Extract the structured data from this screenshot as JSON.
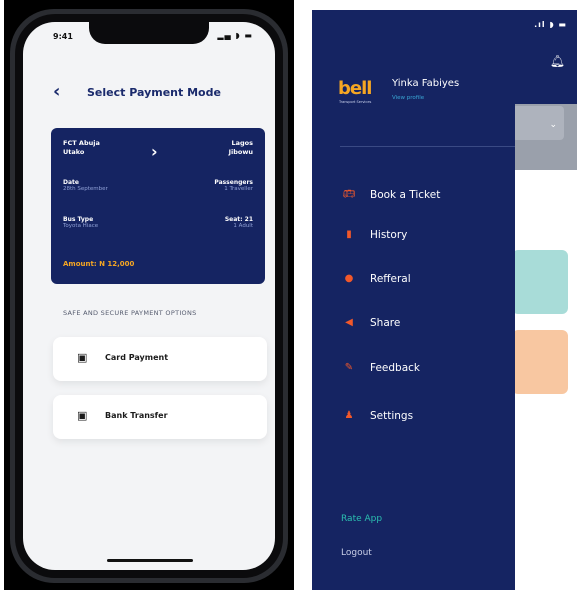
{
  "left": {
    "status": {
      "time": "9:41",
      "icons": "▂▄ ◗ ▬"
    },
    "header": {
      "title": "Select Payment Mode"
    },
    "trip": {
      "from_line1": "FCT Abuja",
      "from_line2": "Utako",
      "to_line1": "Lagos",
      "to_line2": "Jibowu",
      "date_label": "Date",
      "date_value": "28th September",
      "passengers_label": "Passengers",
      "passengers_value": "1 Traveller",
      "bus_label": "Bus Type",
      "bus_value": "Toyota Hiace",
      "seat_label": "Seat: 21",
      "seat_value": "1 Adult",
      "amount": "Amount: N 12,000"
    },
    "secure_label": "SAFE AND SECURE PAYMENT OPTIONS",
    "options": [
      {
        "label": "Card Payment",
        "icon": "wallet-icon"
      },
      {
        "label": "Bank Transfer",
        "icon": "bank-icon"
      }
    ]
  },
  "right": {
    "status_icons": ".ıl ◗ ▬",
    "brand": {
      "text": "bell",
      "sub": "Transport Services"
    },
    "user": {
      "name": "Yinka Fabiyes",
      "link": "View profile"
    },
    "menu": [
      {
        "label": "Book a Ticket",
        "icon": "bus-icon"
      },
      {
        "label": "History",
        "icon": "document-icon"
      },
      {
        "label": "Refferal",
        "icon": "globe-icon"
      },
      {
        "label": "Share",
        "icon": "megaphone-icon"
      },
      {
        "label": "Feedback",
        "icon": "pencil-icon"
      },
      {
        "label": "Settings",
        "icon": "user-settings-icon"
      }
    ],
    "rate_app": "Rate App",
    "logout": "Logout"
  },
  "colors": {
    "primary": "#152462",
    "accent": "#f5a623",
    "menu_icon": "#f2582a",
    "teal": "#2bbfb0",
    "link": "#3aa7d6"
  }
}
